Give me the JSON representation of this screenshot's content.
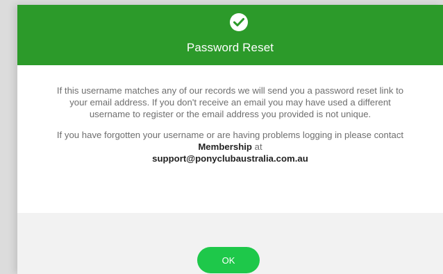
{
  "dialog": {
    "title": "Password Reset",
    "header_color": "#2c9a2a",
    "icon": "check-circle-icon",
    "paragraph1": "If this username matches any of our records we will send you a password reset link to your email address. If you don't receive an email you may have used a different username to register or the email address you provided is not unique.",
    "paragraph2_prefix": "If you have forgotten your username or are having problems logging in please contact ",
    "paragraph2_contact": "Membership",
    "paragraph2_at": " at",
    "support_email": "support@ponyclubaustralia.com.au",
    "ok_label": "OK",
    "ok_color": "#1ec84a"
  }
}
